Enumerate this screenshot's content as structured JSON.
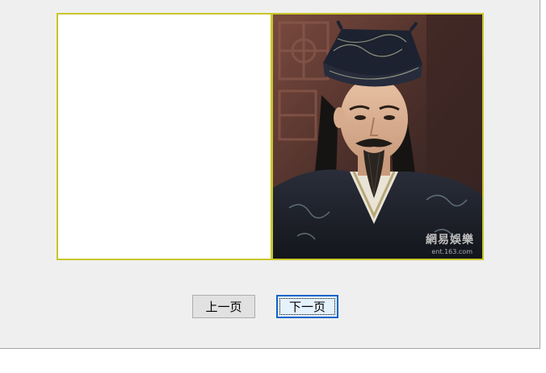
{
  "viewer": {
    "photo_watermark": "網易娛樂",
    "photo_watermark_sub": "ent.163.com"
  },
  "buttons": {
    "prev_label": "上一页",
    "next_label": "下一页"
  },
  "colors": {
    "panel_border": "#c9c62a",
    "window_bg": "#efefef",
    "button_bg": "#e1e1e1",
    "focus_border": "#0a64c9"
  }
}
